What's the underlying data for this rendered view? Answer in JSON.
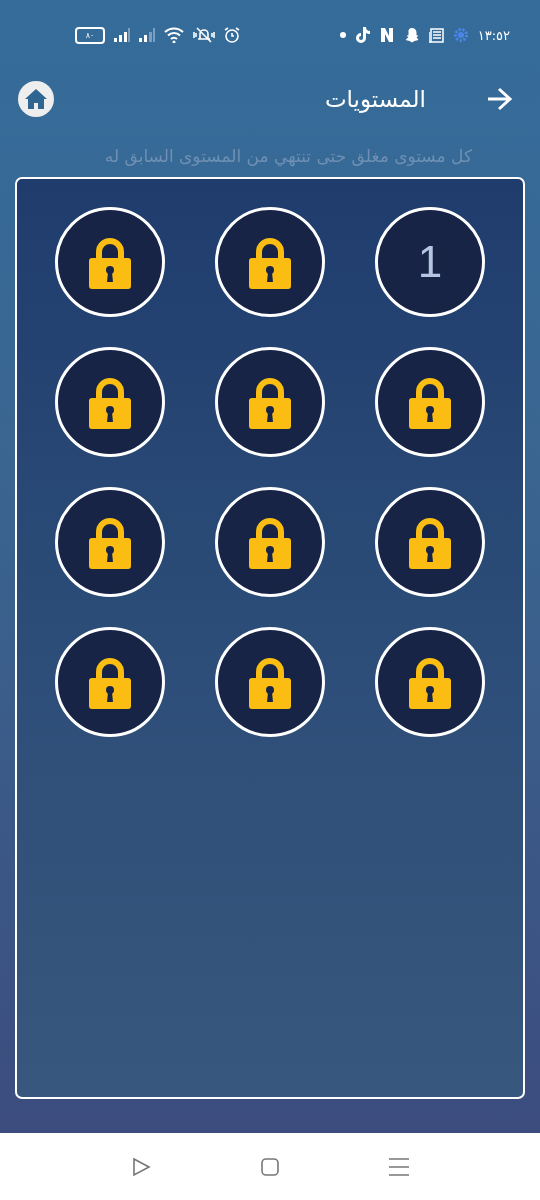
{
  "status_bar": {
    "time": "١٣:٥٢",
    "battery": "٨٠"
  },
  "header": {
    "title": "المستويات"
  },
  "subtitle": "كل مستوى مغلق حتى تنتهي من المستوى السابق له",
  "levels": [
    {
      "kind": "open",
      "label": "1"
    },
    {
      "kind": "locked"
    },
    {
      "kind": "locked"
    },
    {
      "kind": "locked"
    },
    {
      "kind": "locked"
    },
    {
      "kind": "locked"
    },
    {
      "kind": "locked"
    },
    {
      "kind": "locked"
    },
    {
      "kind": "locked"
    },
    {
      "kind": "locked"
    },
    {
      "kind": "locked"
    },
    {
      "kind": "locked"
    }
  ]
}
